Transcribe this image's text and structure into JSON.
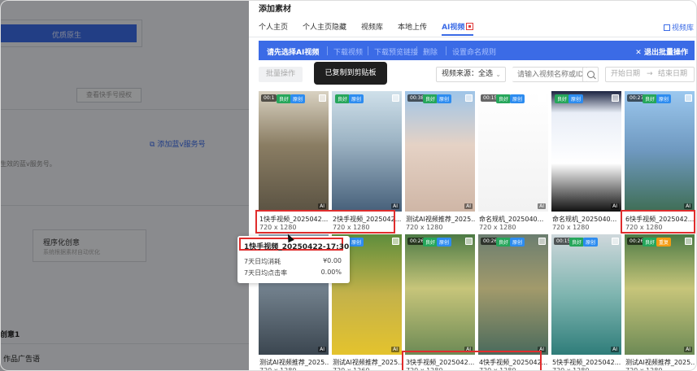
{
  "background": {
    "blue_bar_label": "优质原生",
    "button_label": "查看快手号授权",
    "link_label": "添加蓝v服务号",
    "hint": "生效的蓝v服务号。",
    "card_title": "程序化创意",
    "card_desc": "系统根据素材自动优化",
    "section_heading": "创意1",
    "sub_heading": "作品广告语"
  },
  "drawer": {
    "title": "添加素材",
    "tabs": [
      {
        "label": "个人主页",
        "active": false
      },
      {
        "label": "个人主页隐藏",
        "active": false
      },
      {
        "label": "视频库",
        "active": false
      },
      {
        "label": "本地上传",
        "active": false
      },
      {
        "label": "AI视频",
        "active": true
      }
    ],
    "video_library_link": "视频库",
    "batch_bar": {
      "title": "请先选择AI视频",
      "actions": [
        "下载视频",
        "下载预览链接",
        "删除",
        "设置命名规则"
      ],
      "exit_label": "退出批量操作"
    },
    "filters": {
      "batch_button": "批量操作",
      "source_select": "视频来源：全选",
      "search_placeholder": "请输入视频名称或ID",
      "date_start": "开始日期",
      "date_arrow": "→",
      "date_end": "结束日期"
    },
    "toast": "已复制到剪贴板",
    "videos": [
      {
        "name": "1快手视频_2025042...",
        "res": "720 x 1280",
        "duration": "00:1",
        "tags": [
          "良好",
          "原创"
        ],
        "theme": "warehouse"
      },
      {
        "name": "2快手视频_2025042...",
        "res": "720 x 1280",
        "duration": "",
        "tags": [
          "良好",
          "原创"
        ],
        "theme": "laptop"
      },
      {
        "name": "测试AI视频推荐_2025...",
        "res": "720 x 1280",
        "duration": "00:38",
        "tags": [
          "良好",
          "原创"
        ],
        "theme": "person"
      },
      {
        "name": "命名规机_2025040...",
        "res": "720 x 1280",
        "duration": "00:15",
        "tags": [
          "良好",
          "原创"
        ],
        "theme": "file"
      },
      {
        "name": "命名规机_2025040...",
        "res": "720 x 1280",
        "duration": "",
        "tags": [
          "良好",
          "原创"
        ],
        "theme": "doc"
      },
      {
        "name": "6快手视频_2025042...",
        "res": "720 x 1280",
        "duration": "00:27",
        "tags": [
          "良好",
          "原创"
        ],
        "theme": "city"
      },
      {
        "name": "测试AI视频推荐_2025...",
        "res": "720 x 1280",
        "duration": "",
        "tags": [
          "良好",
          "原创"
        ],
        "theme": "factory"
      },
      {
        "name": "测试AI视频推荐_2025...",
        "res": "720 x 1260",
        "duration": "",
        "tags": [
          "良好",
          "原创"
        ],
        "theme": "bottles"
      },
      {
        "name": "3快手视频_2025042...",
        "res": "720 x 1280",
        "duration": "00:26",
        "tags": [
          "良好",
          "原创"
        ],
        "theme": "glass"
      },
      {
        "name": "4快手视频_2025042...",
        "res": "720 x 1280",
        "duration": "00:26",
        "tags": [
          "良好",
          "原创"
        ],
        "theme": "line"
      },
      {
        "name": "5快手视频_2025042...",
        "res": "720 x 1280",
        "duration": "00:15",
        "tags": [
          "良好",
          "原创"
        ],
        "theme": "conveyor"
      },
      {
        "name": "测试AI视频推荐_2025...",
        "res": "720 x 1280",
        "duration": "00:26",
        "tags": [
          "良好",
          "重复"
        ],
        "theme": "glass"
      }
    ],
    "ai_mark": "AI",
    "tooltip": {
      "title": "1快手视频_20250422-17:30",
      "rows": [
        {
          "label": "7天日均消耗",
          "value": "¥0.00"
        },
        {
          "label": "7天日均点击率",
          "value": "0.00%"
        }
      ]
    },
    "colors": {
      "accent": "#3b6be6",
      "highlight": "#e02d2d",
      "good": "#26a65b",
      "original": "#2d8cf0",
      "duplicate": "#f39c12"
    }
  }
}
